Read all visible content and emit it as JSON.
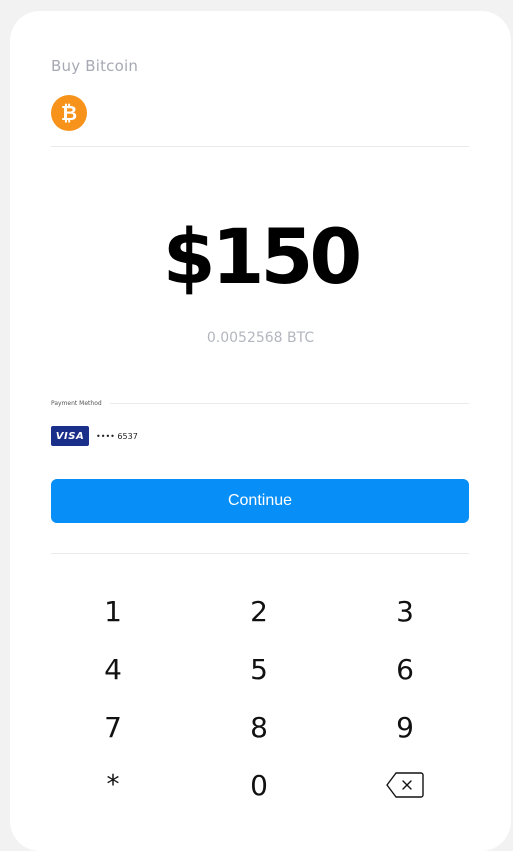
{
  "header": {
    "title": "Buy Bitcoin",
    "coin_icon": "bitcoin-icon",
    "coin_color": "#f7931a",
    "coin_symbol": "₿"
  },
  "amount": {
    "fiat": "$150",
    "crypto": "0.0052568 BTC"
  },
  "payment": {
    "label": "Payment Method",
    "card_brand": "VISA",
    "card_masked": "•••• 6537"
  },
  "action": {
    "continue_label": "Continue",
    "accent": "#078ff7"
  },
  "keypad": {
    "keys": [
      "1",
      "2",
      "3",
      "4",
      "5",
      "6",
      "7",
      "8",
      "9",
      "*",
      "0"
    ],
    "backspace_icon": "backspace-icon"
  }
}
